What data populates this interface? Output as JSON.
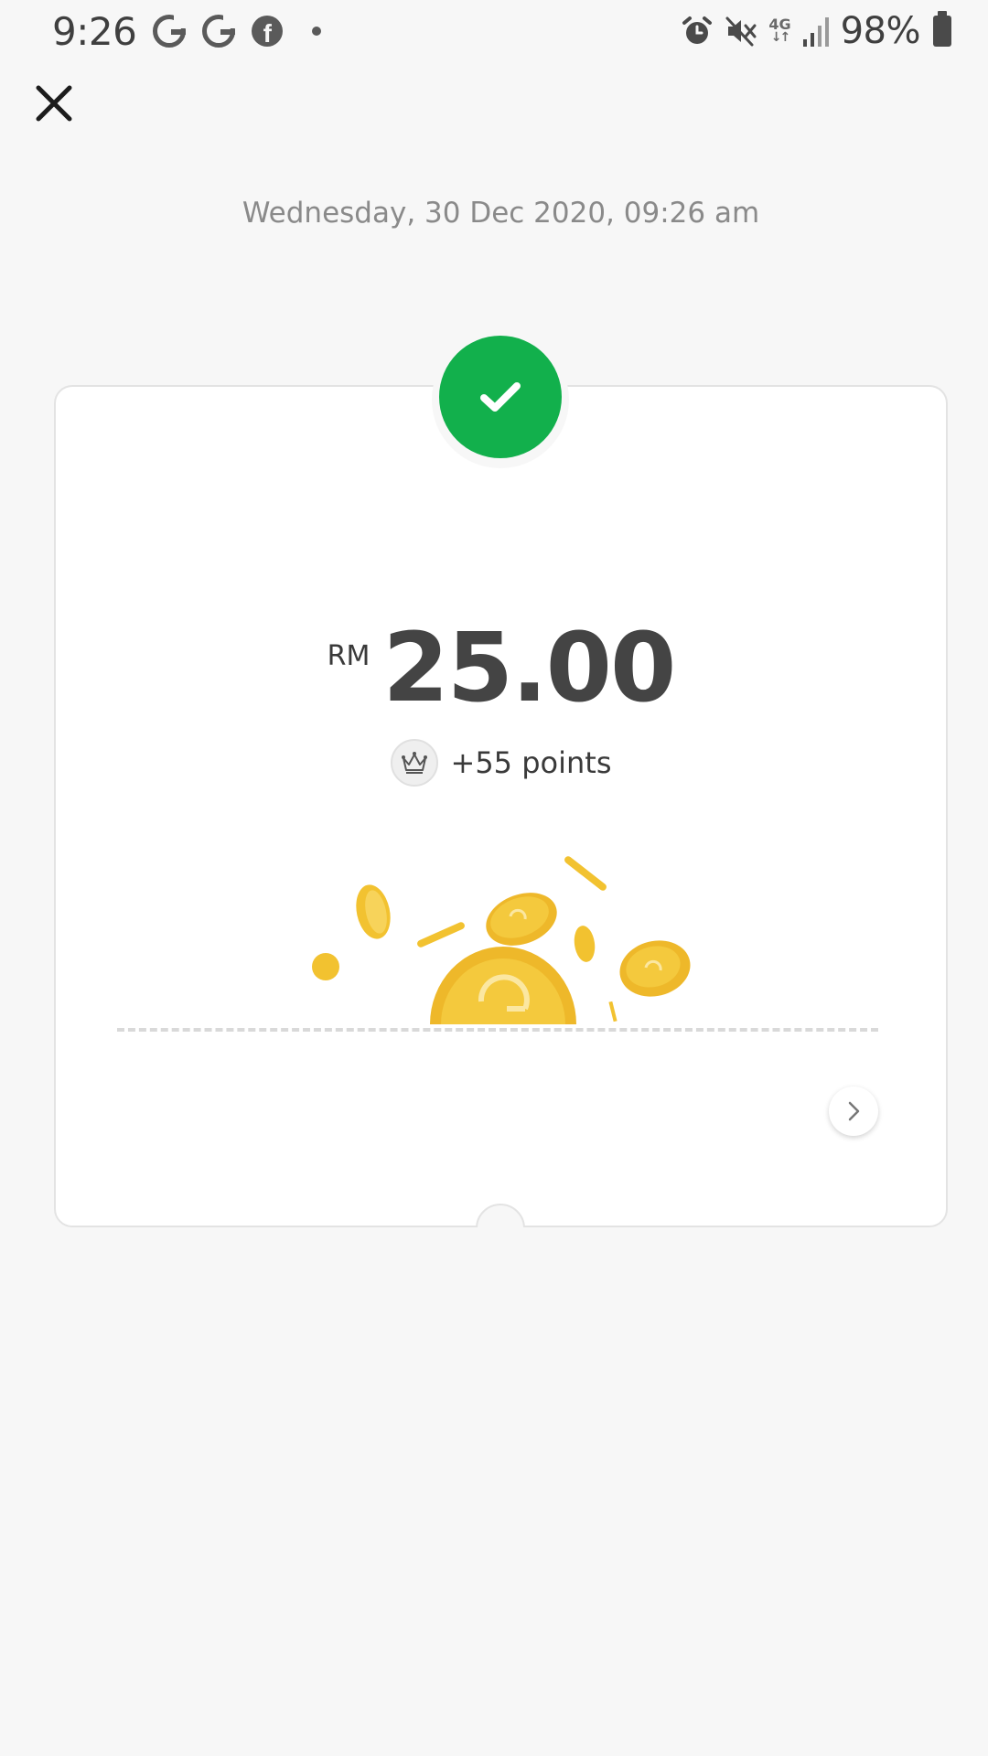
{
  "status_bar": {
    "time": "9:26",
    "left_icons": [
      "grab-g-icon",
      "grab-g-icon",
      "facebook-icon",
      "dot-icon"
    ],
    "right_icons": [
      "alarm-icon",
      "mute-icon",
      "network-4g-icon",
      "signal-icon",
      "battery-icon"
    ],
    "network_label": "4G",
    "battery_percent": "98%"
  },
  "header": {
    "close_icon": "close-icon"
  },
  "receipt": {
    "datetime": "Wednesday, 30 Dec 2020, 09:26 am",
    "status_icon": "checkmark-icon",
    "currency": "RM",
    "amount": "25.00",
    "points": "+55 points",
    "points_icon": "crown-icon",
    "illustration": "gold-coins-illustration",
    "next_icon": "chevron-right-icon"
  },
  "colors": {
    "success_green": "#12b04c",
    "coin_gold": "#f2c230",
    "background": "#f7f7f7"
  }
}
